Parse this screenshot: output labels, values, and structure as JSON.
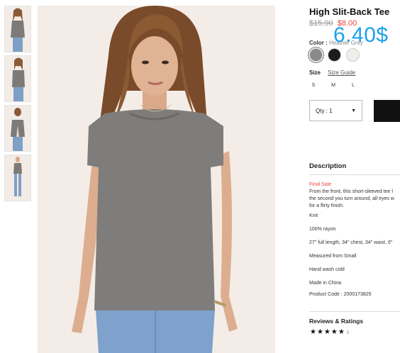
{
  "product": {
    "title": "High Slit-Back Tee",
    "old_price": "$15.90",
    "sale_price": "$8.00",
    "overlay_price": "6.40$"
  },
  "color": {
    "label": "Color :",
    "selected_name": "Heather Grey",
    "swatches": [
      {
        "name": "heather-grey",
        "hex": "#8c8a88"
      },
      {
        "name": "black",
        "hex": "#1d1d1d"
      },
      {
        "name": "cream",
        "hex": "#f1eeea"
      }
    ]
  },
  "size": {
    "label": "Size",
    "guide_link": "Size Guide",
    "options": [
      "S",
      "M",
      "L"
    ]
  },
  "quantity": {
    "label": "Qty : 1"
  },
  "description": {
    "heading": "Description",
    "final_sale": "Final Sale",
    "lines": [
      "From the front, this short-sleeved tee l",
      "the second you turn around, all eyes w",
      "for a flirty finish."
    ],
    "details": [
      "Knit",
      "100% rayon",
      "27\" full length, 34\" chest, 34\" waist, 6\"",
      "Measured from Small",
      "Hand wash cold",
      "Made in China",
      "Product Code : 2000173825"
    ]
  },
  "reviews": {
    "heading": "Reviews & Ratings",
    "stars": "★★★★★",
    "count": "5"
  }
}
